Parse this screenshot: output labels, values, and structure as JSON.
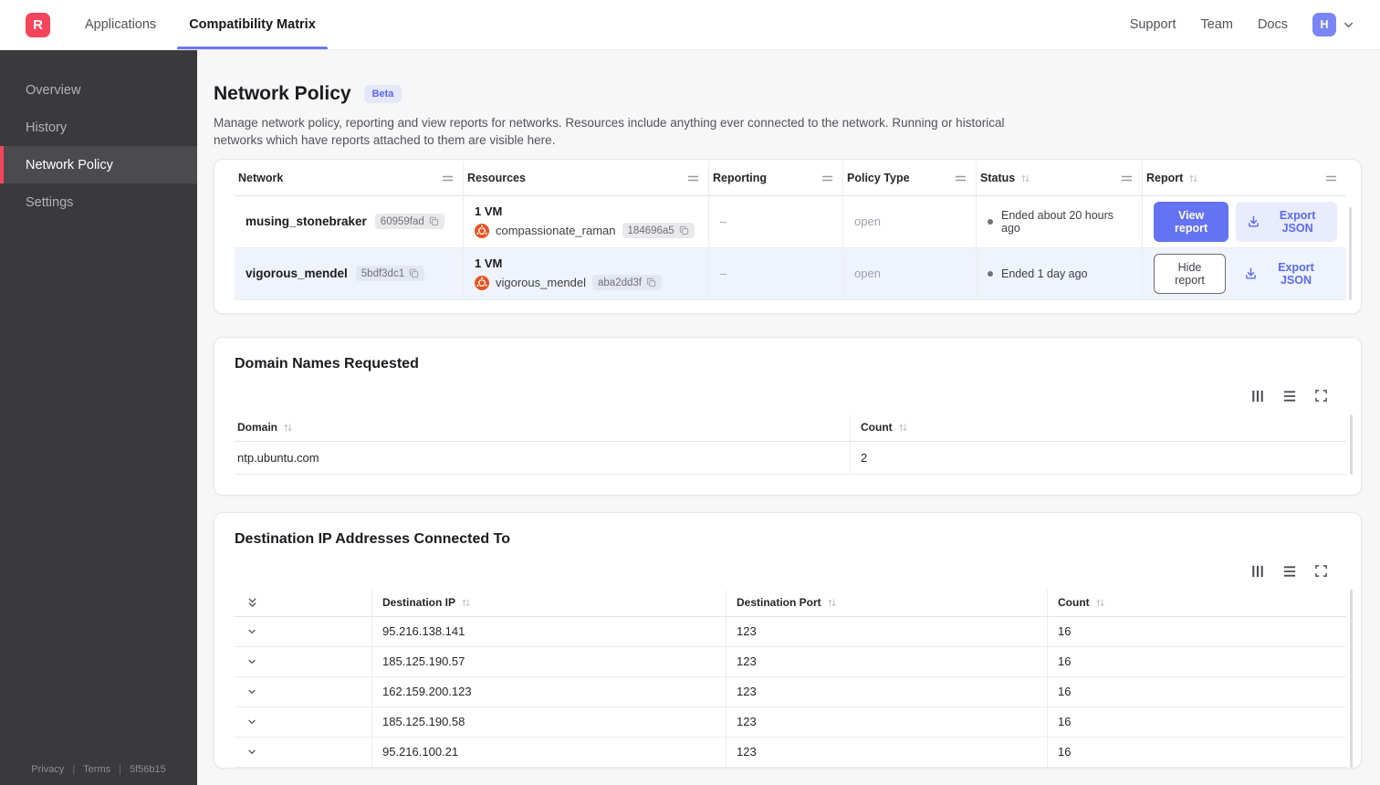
{
  "colors": {
    "brand_red": "#F5455C",
    "accent_indigo": "#6473F2",
    "ubuntu_orange": "#E95420",
    "selected_row_bg": "#EEF3FC",
    "sidebar_bg": "#3A3A3C"
  },
  "topnav": {
    "logo_letter": "R",
    "tabs": [
      {
        "label": "Applications"
      },
      {
        "label": "Compatibility Matrix"
      }
    ],
    "links": [
      {
        "label": "Support"
      },
      {
        "label": "Team"
      },
      {
        "label": "Docs"
      }
    ],
    "avatar_letter": "H"
  },
  "sidebar": {
    "items": [
      {
        "label": "Overview"
      },
      {
        "label": "History"
      },
      {
        "label": "Network Policy"
      },
      {
        "label": "Settings"
      }
    ],
    "footer": {
      "privacy": "Privacy",
      "terms": "Terms",
      "build": "5f56b15"
    }
  },
  "page": {
    "title": "Network Policy",
    "beta_badge": "Beta",
    "description": "Manage network policy, reporting and view reports for networks. Resources include anything ever connected to the network. Running or historical networks which have reports attached to them are visible here."
  },
  "networks_table": {
    "columns": {
      "network": "Network",
      "resources": "Resources",
      "reporting": "Reporting",
      "policy_type": "Policy Type",
      "status": "Status",
      "report": "Report"
    },
    "rows": [
      {
        "name": "musing_stonebraker",
        "hash": "60959fad",
        "resources_summary": "1 VM",
        "resource_name": "compassionate_raman",
        "resource_hash": "184696a5",
        "reporting": "–",
        "policy_type": "open",
        "status": "Ended about 20 hours ago",
        "report_action": "View report",
        "export_action": "Export JSON"
      },
      {
        "name": "vigorous_mendel",
        "hash": "5bdf3dc1",
        "resources_summary": "1 VM",
        "resource_name": "vigorous_mendel",
        "resource_hash": "aba2dd3f",
        "reporting": "–",
        "policy_type": "open",
        "status": "Ended 1 day ago",
        "report_action": "Hide report",
        "export_action": "Export JSON"
      }
    ]
  },
  "domains_card": {
    "title": "Domain Names Requested",
    "columns": {
      "domain": "Domain",
      "count": "Count"
    },
    "rows": [
      {
        "domain": "ntp.ubuntu.com",
        "count": "2"
      }
    ]
  },
  "destinations_card": {
    "title": "Destination IP Addresses Connected To",
    "columns": {
      "ip": "Destination IP",
      "port": "Destination Port",
      "count": "Count"
    },
    "rows": [
      {
        "ip": "95.216.138.141",
        "port": "123",
        "count": "16"
      },
      {
        "ip": "185.125.190.57",
        "port": "123",
        "count": "16"
      },
      {
        "ip": "162.159.200.123",
        "port": "123",
        "count": "16"
      },
      {
        "ip": "185.125.190.58",
        "port": "123",
        "count": "16"
      },
      {
        "ip": "95.216.100.21",
        "port": "123",
        "count": "16"
      }
    ]
  }
}
